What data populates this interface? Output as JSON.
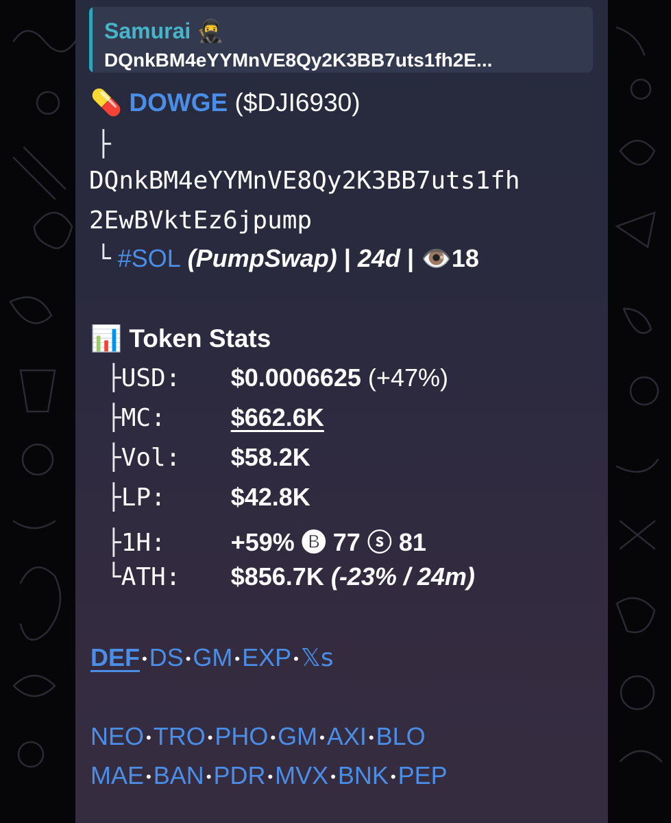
{
  "reply": {
    "name": "Samurai",
    "name_emoji": "🥷",
    "text": "DQnkBM4eYYMnVE8Qy2K3BB7uts1fh2E..."
  },
  "token": {
    "emoji": "💊",
    "name": "DOWGE",
    "symbol": "($DJI6930)",
    "branch": "├",
    "address_line1": "DQnkBM4eYYMnVE8Qy2K3BB7uts1fh",
    "address_line2": "2EwBVktEz6jpump",
    "end_branch": "└",
    "chain": "#SOL",
    "dex": "(PumpSwap)",
    "sep1": "|",
    "age": "24d",
    "sep2": "|",
    "views_emoji": "👁️",
    "views": "18"
  },
  "stats": {
    "emoji": "📊",
    "title": "Token Stats",
    "rows": [
      {
        "branch": "├",
        "label": "USD:",
        "value": "$0.0006625",
        "extra": "(+47%)"
      },
      {
        "branch": "├",
        "label": "MC:",
        "value": "$662.6K",
        "extra": ""
      },
      {
        "branch": "├",
        "label": "Vol:",
        "value": "$58.2K",
        "extra": ""
      },
      {
        "branch": "├",
        "label": "LP:",
        "value": "$42.8K",
        "extra": ""
      },
      {
        "branch": "├",
        "label": "1H:",
        "value": "+59% 🅑 77 ⓢ 81",
        "extra": ""
      },
      {
        "branch": "└",
        "label": "ATH:",
        "value": "$856.7K",
        "extra": "(-23% / 24m)"
      }
    ]
  },
  "links_primary": [
    "DEF",
    "DS",
    "GM",
    "EXP",
    "𝕏s"
  ],
  "links_row1": [
    "NEO",
    "TRO",
    "PHO",
    "GM",
    "AXI",
    "BLO"
  ],
  "links_row2": [
    "MAE",
    "BAN",
    "PDR",
    "MVX",
    "BNK",
    "PEP"
  ],
  "separator": "•",
  "colors": {
    "link": "#4a8ee8",
    "reply_name": "#48b4c8",
    "reply_bar": "#2aa7bd"
  }
}
